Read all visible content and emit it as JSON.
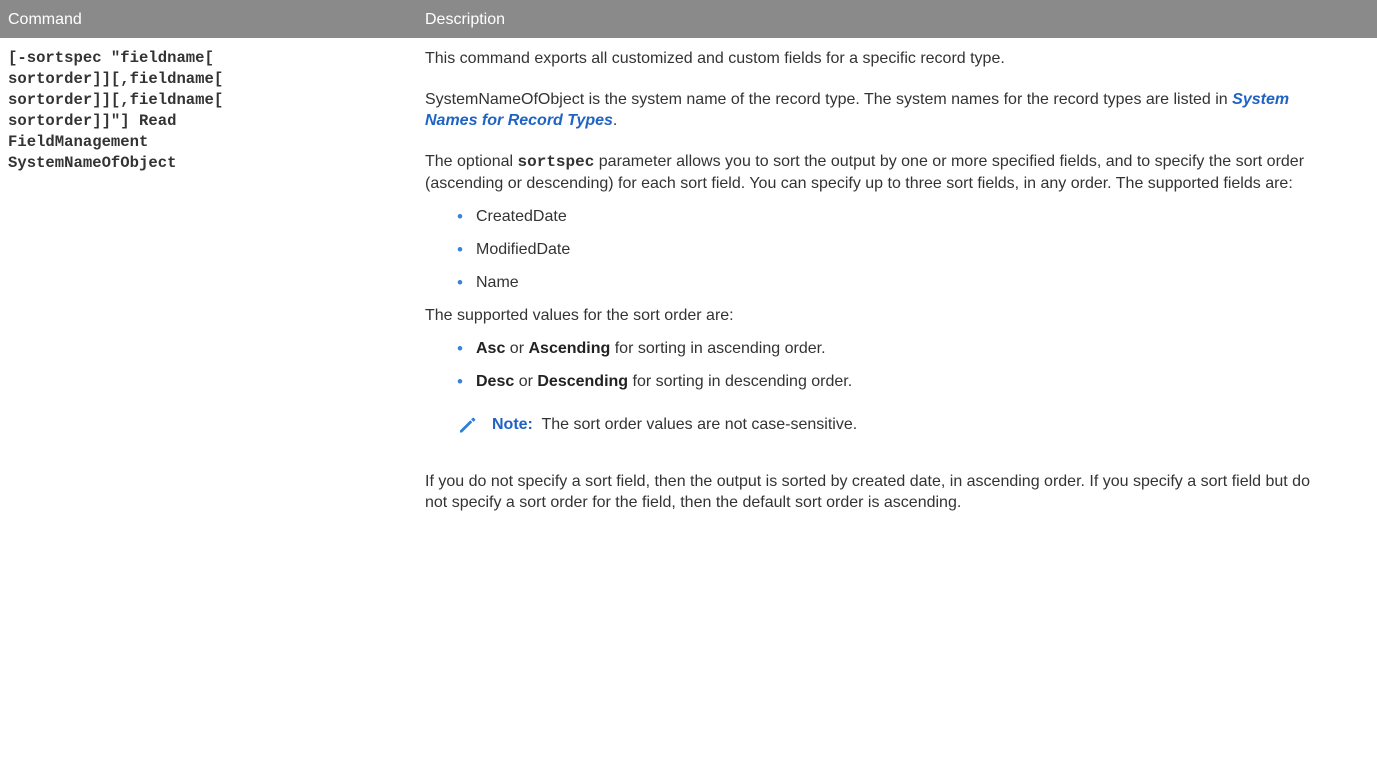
{
  "header": {
    "command": "Command",
    "description": "Description"
  },
  "command_lines": [
    "[-sortspec \"fieldname[",
    "sortorder]][,fieldname[",
    "sortorder]][,fieldname[",
    "sortorder]]\"] Read",
    "FieldManagement",
    "SystemNameOfObject"
  ],
  "description": {
    "intro": "This command exports all customized and custom fields for a specific record type.",
    "sysname_before": "SystemNameOfObject is the system name of the record type. The system names for the record types are listed in ",
    "sysname_link": "System Names for Record Types",
    "sysname_after": ".",
    "sortspec_before": "The optional ",
    "sortspec_param": "sortspec",
    "sortspec_after": " parameter allows you to sort the output by one or more specified fields, and to specify the sort order (ascending or descending) for each sort field. You can specify up to three sort fields, in any order. The supported fields are:",
    "fields": [
      "CreatedDate",
      "ModifiedDate",
      "Name"
    ],
    "values_intro": "The supported values for the sort order are:",
    "values": [
      {
        "a": "Asc",
        "or": " or ",
        "b": "Ascending",
        "rest": " for sorting in ascending order."
      },
      {
        "a": "Desc",
        "or": " or ",
        "b": "Descending",
        "rest": " for sorting in descending order."
      }
    ],
    "note_label": "Note:",
    "note_text": "  The sort order values are not case-sensitive.",
    "closing": "If you do not specify a sort field, then the output is sorted by created date, in ascending order. If you specify a sort field but do not specify a sort order for the field, then the default sort order is ascending."
  },
  "colors": {
    "header_bg": "#8a8a8a",
    "link": "#1f63c3",
    "bullet": "#3b83d9",
    "icon": "#2f7fd6"
  },
  "icons": {
    "bullet": "•",
    "note": "pencil-icon"
  }
}
